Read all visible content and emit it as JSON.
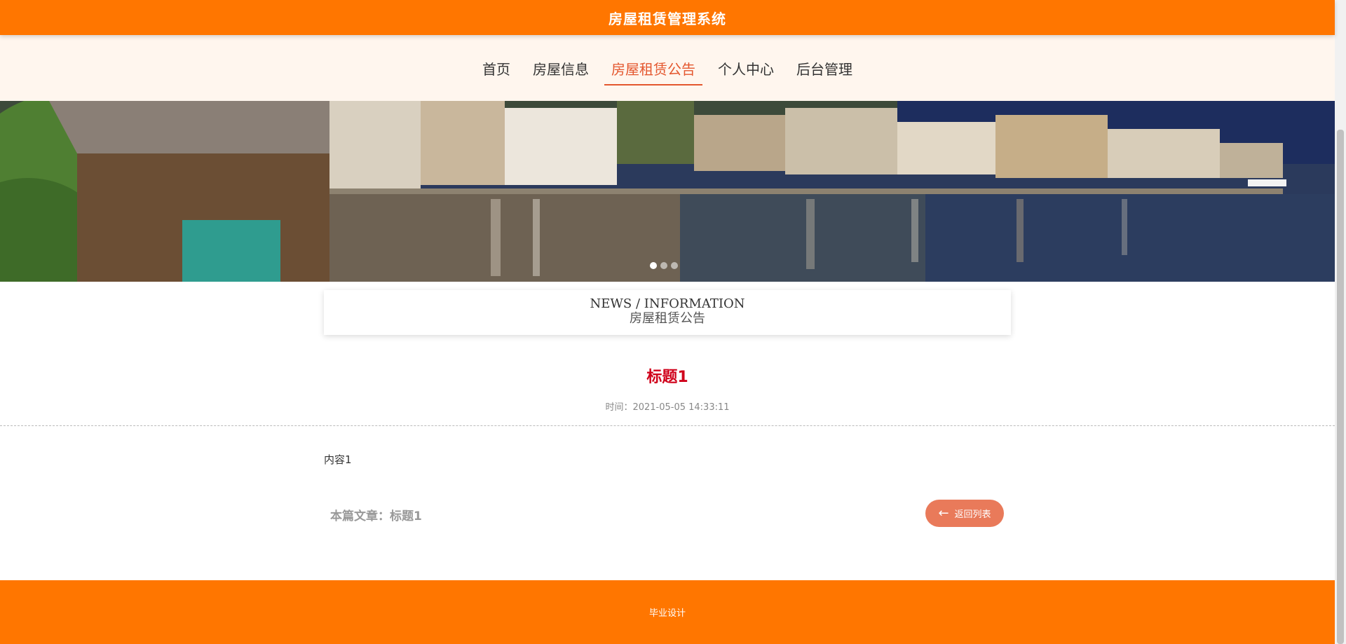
{
  "header": {
    "title": "房屋租赁管理系统"
  },
  "nav": {
    "items": [
      {
        "label": "首页"
      },
      {
        "label": "房屋信息"
      },
      {
        "label": "房屋租赁公告"
      },
      {
        "label": "个人中心"
      },
      {
        "label": "后台管理"
      }
    ],
    "active_index": 2
  },
  "banner": {
    "slide_count": 3,
    "active_slide": 1
  },
  "section": {
    "title_en": "NEWS / INFORMATION",
    "title_zh": "房屋租赁公告"
  },
  "article": {
    "title": "标题1",
    "time": "时间：2021-05-05 14:33:11",
    "content": "内容1",
    "this_article": "本篇文章：标题1"
  },
  "back_button": {
    "label": "返回列表",
    "icon": "arrow-left-icon"
  },
  "footer": {
    "text": "毕业设计"
  },
  "colors": {
    "primary": "#ff7600",
    "accent": "#e4572e",
    "title_red": "#d0021b",
    "button": "#e97a5a"
  }
}
